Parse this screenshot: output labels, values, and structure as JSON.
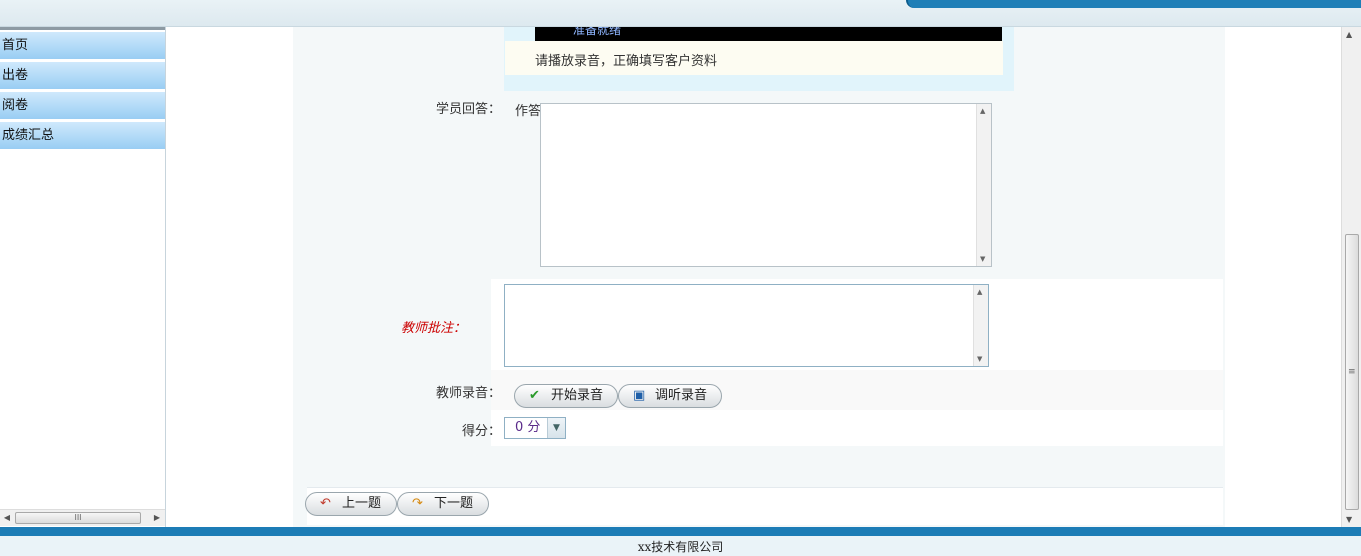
{
  "sidebar": {
    "items": [
      {
        "label": "首页"
      },
      {
        "label": "出卷"
      },
      {
        "label": "阅卷"
      },
      {
        "label": "成绩汇总"
      }
    ]
  },
  "question": {
    "player_status": "准备就绪",
    "prompt": "请播放录音，正确填写客户资料"
  },
  "answer": {
    "label": "学员回答：",
    "prefix": "作答"
  },
  "teacher": {
    "comment_label": "教师批注：",
    "record_label": "教师录音：",
    "start_record_button": "开始录音",
    "listen_record_button": "调听录音"
  },
  "score": {
    "label": "得分：",
    "selected": "0 分"
  },
  "nav": {
    "prev_button": "上一题",
    "next_button": "下一题"
  },
  "footer": {
    "copyright": "xx技术有限公司"
  },
  "colors": {
    "comment_label": "#cc0000",
    "menu_top": "#cfe9fc",
    "menu_bottom": "#99cdf3",
    "footer_stripe": "#1c7cb6"
  },
  "icons": {
    "start_record": "check-icon",
    "listen_record": "save-icon",
    "prev": "back-arrow-icon",
    "next": "forward-arrow-icon"
  }
}
